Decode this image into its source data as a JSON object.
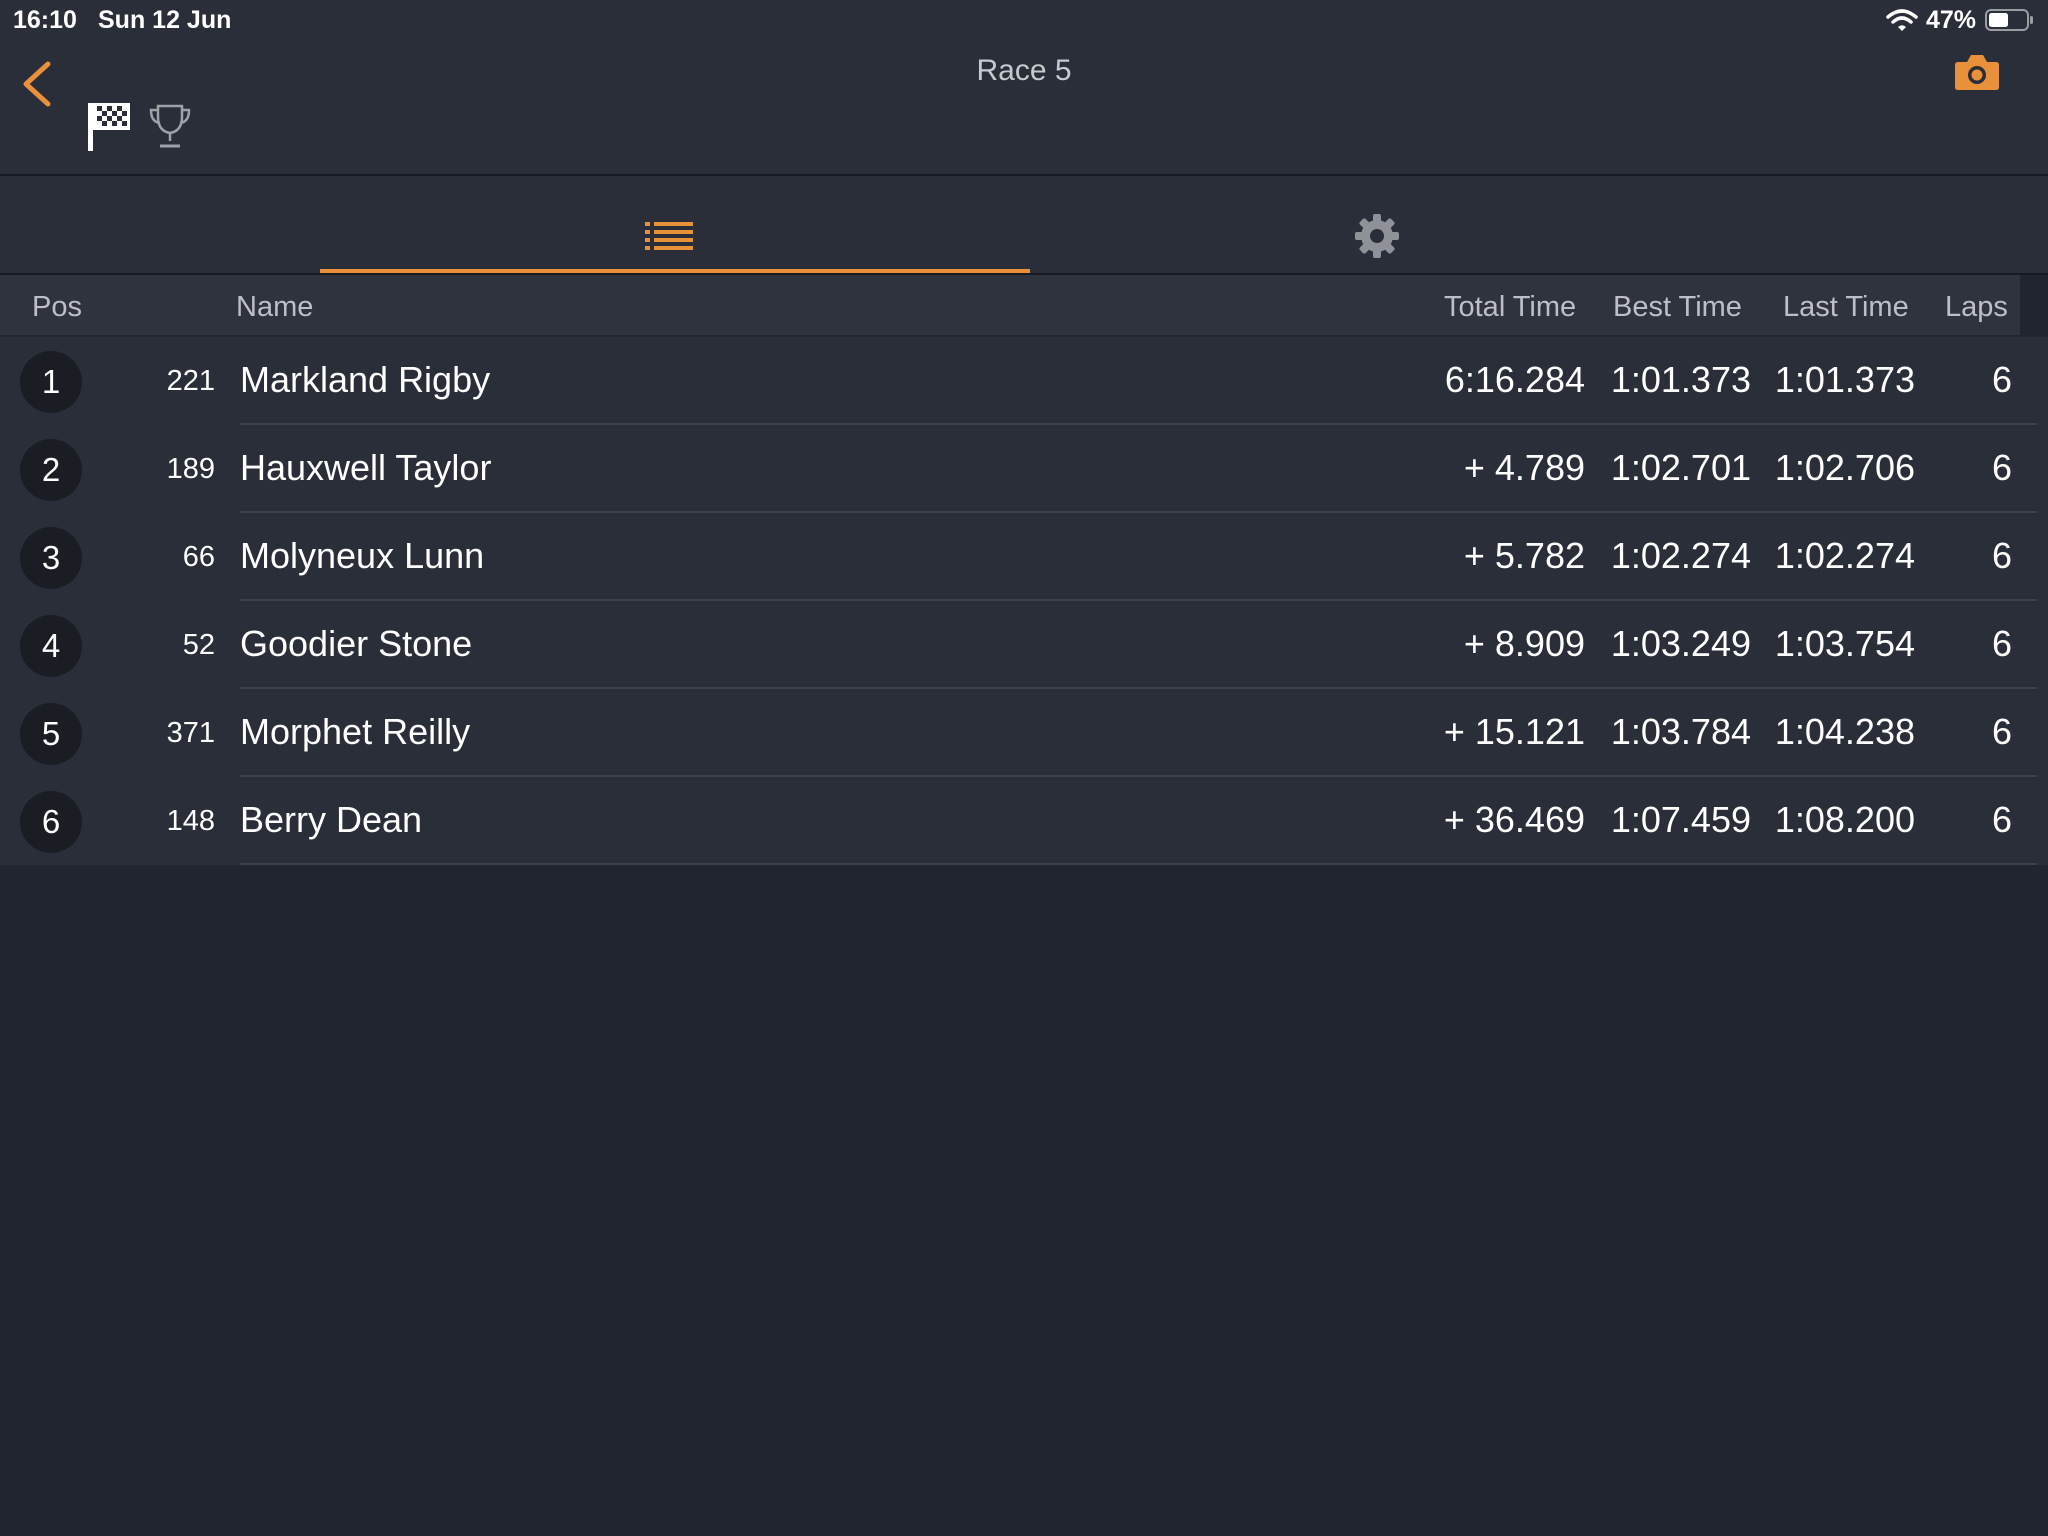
{
  "status": {
    "time": "16:10",
    "date": "Sun 12 Jun",
    "battery": "47%"
  },
  "header": {
    "title": "Race 5"
  },
  "colors": {
    "accent": "#e8913a",
    "background": "#212530",
    "panel": "#2a2e38"
  },
  "icons": {
    "back": "chevron-left-icon",
    "flag": "checkered-flag-icon",
    "trophy": "trophy-icon",
    "camera": "camera-icon",
    "list": "list-icon",
    "settings": "gear-icon"
  },
  "table": {
    "columns": {
      "pos": "Pos",
      "name": "Name",
      "total": "Total Time",
      "best": "Best Time",
      "last": "Last Time",
      "laps": "Laps"
    },
    "rows": [
      {
        "pos": "1",
        "kart": "221",
        "name": "Markland Rigby",
        "total": "6:16.284",
        "best": "1:01.373",
        "last": "1:01.373",
        "laps": "6"
      },
      {
        "pos": "2",
        "kart": "189",
        "name": "Hauxwell Taylor",
        "total": "+ 4.789",
        "best": "1:02.701",
        "last": "1:02.706",
        "laps": "6"
      },
      {
        "pos": "3",
        "kart": "66",
        "name": "Molyneux Lunn",
        "total": "+ 5.782",
        "best": "1:02.274",
        "last": "1:02.274",
        "laps": "6"
      },
      {
        "pos": "4",
        "kart": "52",
        "name": "Goodier Stone",
        "total": "+ 8.909",
        "best": "1:03.249",
        "last": "1:03.754",
        "laps": "6"
      },
      {
        "pos": "5",
        "kart": "371",
        "name": "Morphet Reilly",
        "total": "+ 15.121",
        "best": "1:03.784",
        "last": "1:04.238",
        "laps": "6"
      },
      {
        "pos": "6",
        "kart": "148",
        "name": "Berry Dean",
        "total": "+ 36.469",
        "best": "1:07.459",
        "last": "1:08.200",
        "laps": "6"
      }
    ]
  }
}
